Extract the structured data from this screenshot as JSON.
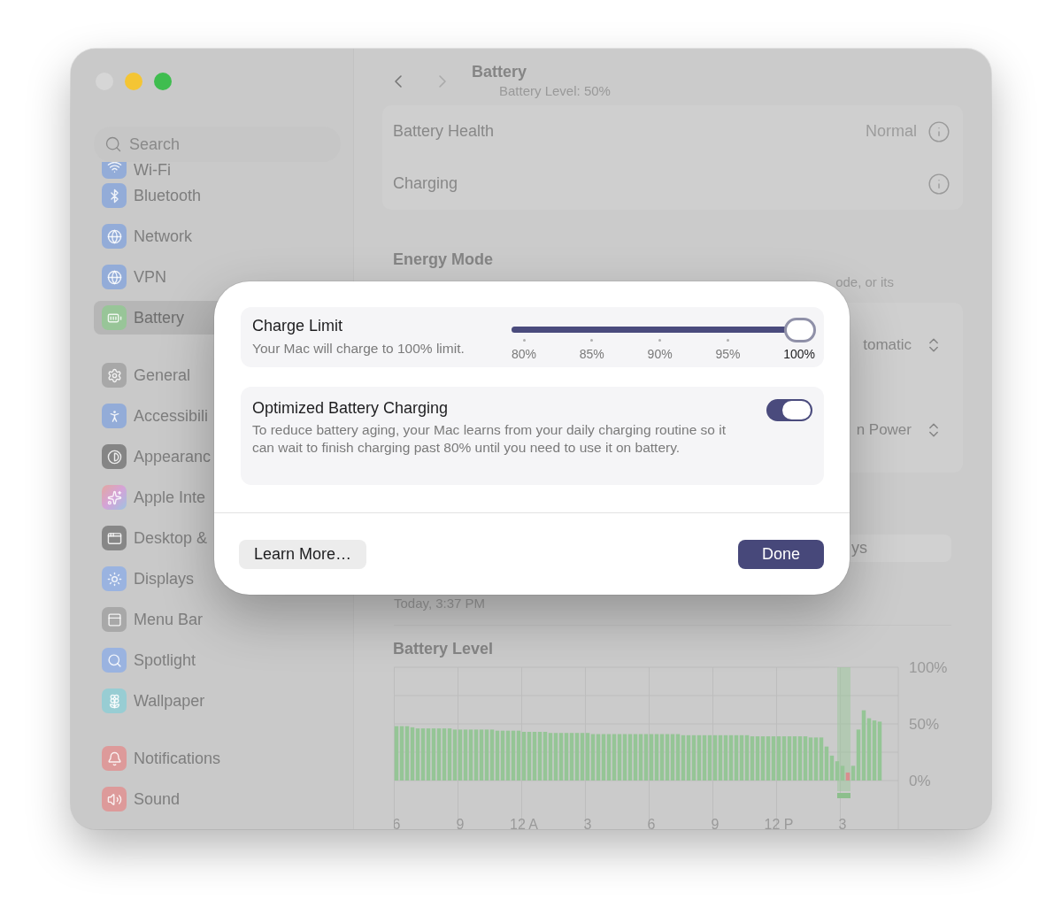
{
  "window": {
    "controls": [
      {
        "kind": "close",
        "disabled": true
      },
      {
        "kind": "minimize",
        "disabled": false
      },
      {
        "kind": "zoom",
        "disabled": false
      }
    ]
  },
  "sidebar": {
    "search": {
      "placeholder": "Search"
    },
    "groups": [
      [
        {
          "label": "Wi-Fi",
          "selected": false
        },
        {
          "label": "Bluetooth",
          "selected": false
        },
        {
          "label": "Network",
          "selected": false
        },
        {
          "label": "VPN",
          "selected": false
        },
        {
          "label": "Battery",
          "selected": true
        }
      ],
      [
        {
          "label": "General",
          "selected": false
        },
        {
          "label": "Accessibili",
          "selected": false
        },
        {
          "label": "Appearanc",
          "selected": false
        },
        {
          "label": "Apple Inte",
          "selected": false
        },
        {
          "label": "Desktop &",
          "selected": false
        },
        {
          "label": "Displays",
          "selected": false
        },
        {
          "label": "Menu Bar",
          "selected": false
        },
        {
          "label": "Spotlight",
          "selected": false
        },
        {
          "label": "Wallpaper",
          "selected": false
        }
      ],
      [
        {
          "label": "Notifications",
          "selected": false
        },
        {
          "label": "Sound",
          "selected": false
        }
      ]
    ]
  },
  "toolbar": {
    "back": {
      "disabled": false
    },
    "forward": {
      "disabled": true
    },
    "title": "Battery",
    "subtitle": "Battery Level: 50%"
  },
  "battery_info": [
    {
      "label": "Battery Health",
      "value": "Normal"
    },
    {
      "label": "Charging"
    }
  ],
  "energy_mode": {
    "title": "Energy Mode",
    "description": "ode, or its",
    "options": [
      {
        "value": "tomatic"
      },
      {
        "value": "n Power"
      }
    ]
  },
  "range_control": {
    "label": "ys"
  },
  "last_charged": "Today, 3:37 PM",
  "battery_level": {
    "chart_data": {
      "type": "bar",
      "title": "Battery Level",
      "ylim": [
        0,
        100
      ],
      "grid": true,
      "yticks": [
        {
          "value": 0,
          "label": "0%"
        },
        {
          "value": 50,
          "label": "50%"
        },
        {
          "value": 100,
          "label": "100%"
        }
      ],
      "categories": [
        "6",
        null,
        null,
        null,
        null,
        null,
        null,
        null,
        null,
        null,
        null,
        null,
        "9",
        null,
        null,
        null,
        null,
        null,
        null,
        null,
        null,
        null,
        null,
        null,
        "12 A",
        null,
        null,
        null,
        null,
        null,
        null,
        null,
        null,
        null,
        null,
        null,
        "3",
        null,
        null,
        null,
        null,
        null,
        null,
        null,
        null,
        null,
        null,
        null,
        "6",
        null,
        null,
        null,
        null,
        null,
        null,
        null,
        null,
        null,
        null,
        null,
        "9",
        null,
        null,
        null,
        null,
        null,
        null,
        null,
        null,
        null,
        null,
        null,
        "12 P",
        null,
        null,
        null,
        null,
        null,
        null,
        null,
        null,
        null,
        null,
        null,
        "3",
        null,
        null,
        null,
        null,
        null,
        null,
        null
      ],
      "series": [
        {
          "color": "#95c596",
          "values": [
            48,
            48,
            48,
            47,
            46,
            46,
            46,
            46,
            46,
            46,
            46,
            45,
            45,
            45,
            45,
            45,
            45,
            45,
            45,
            44,
            44,
            44,
            44,
            44,
            43,
            43,
            43,
            43,
            43,
            42,
            42,
            42,
            42,
            42,
            42,
            42,
            42,
            41,
            41,
            41,
            41,
            41,
            41,
            41,
            41,
            41,
            41,
            41,
            41,
            41,
            41,
            41,
            41,
            41,
            40,
            40,
            40,
            40,
            40,
            40,
            40,
            40,
            40,
            40,
            40,
            40,
            40,
            39,
            39,
            39,
            39,
            39,
            39,
            39,
            39,
            39,
            39,
            39,
            38,
            38,
            38,
            30,
            22,
            17,
            13,
            null,
            13,
            45,
            62,
            55,
            53,
            52
          ]
        },
        {
          "color": "#d98f8f",
          "values": [
            null,
            null,
            null,
            null,
            null,
            null,
            null,
            null,
            null,
            null,
            null,
            null,
            null,
            null,
            null,
            null,
            null,
            null,
            null,
            null,
            null,
            null,
            null,
            null,
            null,
            null,
            null,
            null,
            null,
            null,
            null,
            null,
            null,
            null,
            null,
            null,
            null,
            null,
            null,
            null,
            null,
            null,
            null,
            null,
            null,
            null,
            null,
            null,
            null,
            null,
            null,
            null,
            null,
            null,
            null,
            null,
            null,
            null,
            null,
            null,
            null,
            null,
            null,
            null,
            null,
            null,
            null,
            null,
            null,
            null,
            null,
            null,
            null,
            null,
            null,
            null,
            null,
            null,
            null,
            null,
            null,
            null,
            null,
            null,
            null,
            7,
            null,
            null,
            null,
            null,
            null,
            null
          ]
        }
      ]
    }
  },
  "dialog": {
    "charge_limit": {
      "title": "Charge Limit",
      "description": "Your Mac will charge to 100% limit.",
      "level": 1,
      "ticks": [
        {
          "label": "80%",
          "selected": false
        },
        {
          "label": "85%",
          "selected": false
        },
        {
          "label": "90%",
          "selected": false
        },
        {
          "label": "95%",
          "selected": false
        },
        {
          "label": "100%",
          "selected": true
        }
      ]
    },
    "optimized": {
      "title": "Optimized Battery Charging",
      "description": "To reduce battery aging, your Mac learns from your daily charging routine so it can wait to finish charging past 80% until you need to use it on battery.",
      "on": true
    },
    "buttons": [
      {
        "label": "Learn More…",
        "kind": "secondary"
      },
      {
        "label": "Done",
        "kind": "primary"
      }
    ]
  }
}
